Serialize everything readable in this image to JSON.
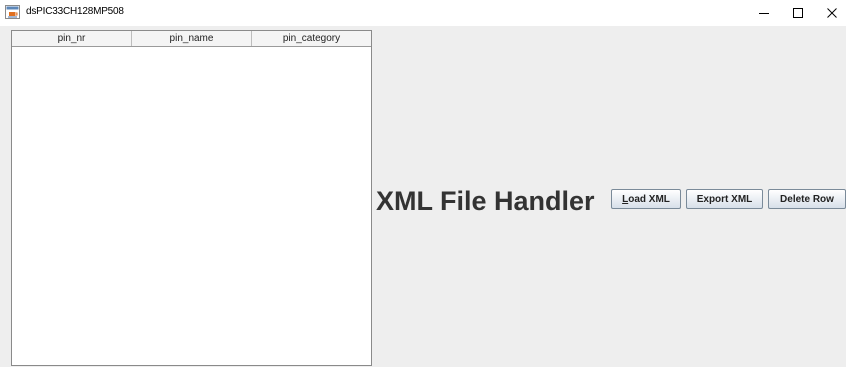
{
  "window": {
    "title": "dsPIC33CH128MP508",
    "app_icon": "java-coffee-icon",
    "controls": [
      "minimize-icon",
      "maximize-icon",
      "close-icon"
    ]
  },
  "table": {
    "columns": [
      "pin_nr",
      "pin_name",
      "pin_category"
    ],
    "rows": []
  },
  "main": {
    "heading": "XML File Handler",
    "buttons": {
      "load_mnemonic": "L",
      "load_rest": "oad XML",
      "export": "Export XML",
      "delete": "Delete Row"
    }
  },
  "colors": {
    "panel_background": "#eeeeee",
    "heading_text": "#333333",
    "button_gradient_top": "#ffffff",
    "button_gradient_bottom": "#d7dfe9"
  }
}
